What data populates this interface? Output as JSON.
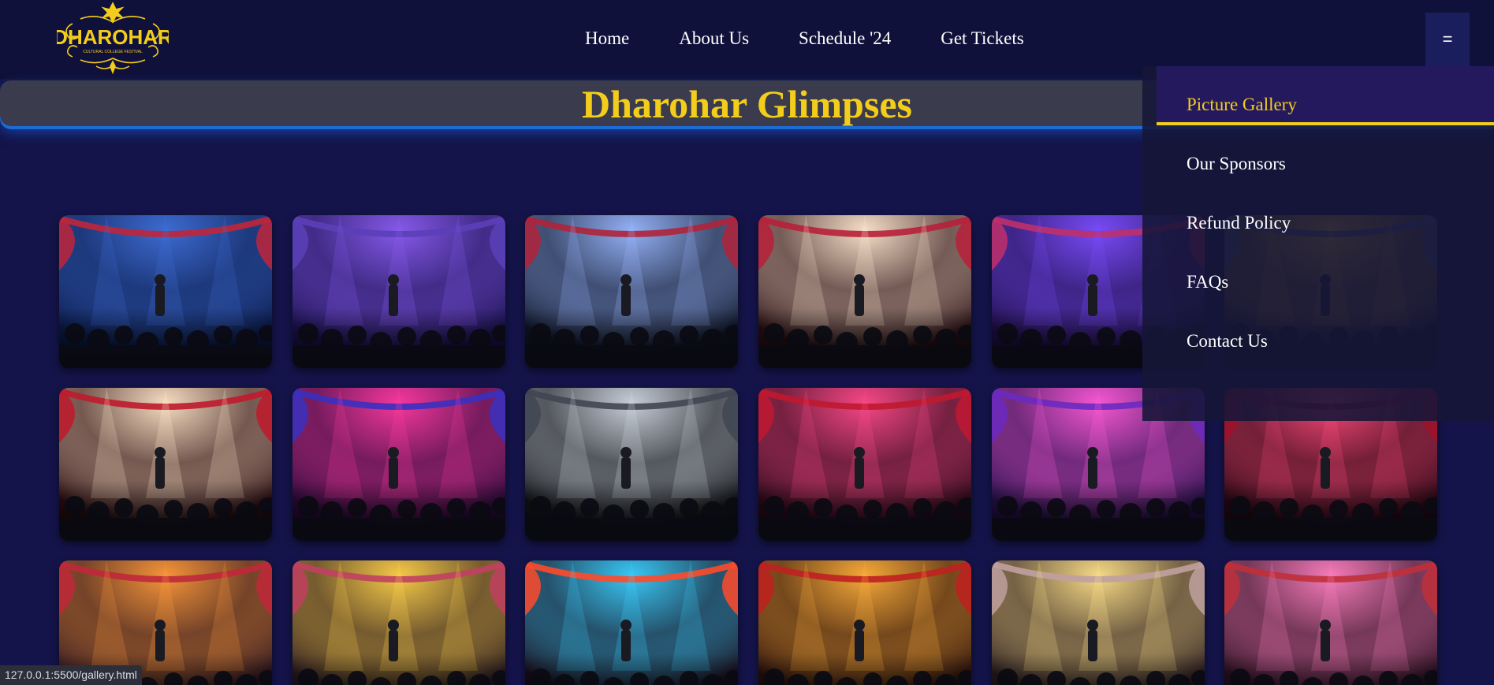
{
  "logo": {
    "text": "DHAROHAR",
    "tagline": "CULTURAL COLLEGE FESTIVAL",
    "color": "#f3cd1c"
  },
  "nav": {
    "items": [
      {
        "label": "Home"
      },
      {
        "label": "About Us"
      },
      {
        "label": "Schedule '24"
      },
      {
        "label": "Get Tickets"
      }
    ],
    "menu_button": "="
  },
  "page_title": "Dharohar Glimpses",
  "dropdown": {
    "items": [
      {
        "label": "Picture Gallery",
        "active": true
      },
      {
        "label": "Our Sponsors"
      },
      {
        "label": "Refund Policy"
      },
      {
        "label": "FAQs"
      },
      {
        "label": "Contact Us"
      }
    ]
  },
  "gallery": {
    "photos": [
      {
        "name": "photo-1-1",
        "scene": "blue-stage"
      },
      {
        "name": "photo-1-2",
        "scene": "purple-stage"
      },
      {
        "name": "photo-1-3",
        "scene": "blue-white-stage"
      },
      {
        "name": "photo-1-4",
        "scene": "red-white-stage"
      },
      {
        "name": "photo-1-5",
        "scene": "violet-stage"
      },
      {
        "name": "photo-1-6",
        "scene": "yellow-stage"
      },
      {
        "name": "photo-2-1",
        "scene": "red-curtain-stage"
      },
      {
        "name": "photo-2-2",
        "scene": "magenta-stage"
      },
      {
        "name": "photo-2-3",
        "scene": "grey-stage"
      },
      {
        "name": "photo-2-4",
        "scene": "red-stage"
      },
      {
        "name": "photo-2-5",
        "scene": "pink-stage"
      },
      {
        "name": "photo-2-6",
        "scene": "crimson-stage"
      },
      {
        "name": "photo-3-1",
        "scene": "orange-stage"
      },
      {
        "name": "photo-3-2",
        "scene": "gold-stage"
      },
      {
        "name": "photo-3-3",
        "scene": "rainbow-stage"
      },
      {
        "name": "photo-3-4",
        "scene": "amber-stage"
      },
      {
        "name": "photo-3-5",
        "scene": "warm-stage"
      },
      {
        "name": "photo-3-6",
        "scene": "rose-stage"
      }
    ]
  },
  "status_bar": {
    "url": "127.0.0.1:5500/gallery.html"
  },
  "colors": {
    "background": "#14144a",
    "header": "#10113a",
    "accent": "#f3cd1c",
    "title_band": "#3a3b4c",
    "glow": "#1e6ad6",
    "dropdown_active": "#25195e"
  }
}
